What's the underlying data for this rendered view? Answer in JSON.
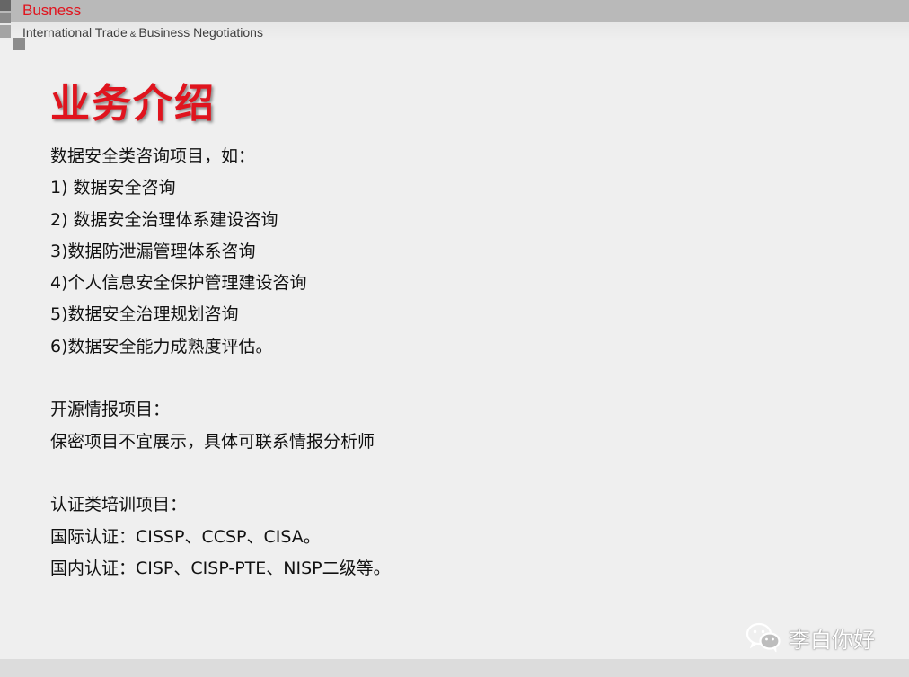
{
  "header": {
    "brand": "Busness",
    "subtitle_part1": "International Trade",
    "subtitle_amp": "&",
    "subtitle_part2": "Business Negotiations"
  },
  "title": "业务介绍",
  "content": {
    "lines": [
      "数据安全类咨询项目，如：",
      "1) 数据安全咨询",
      "2) 数据安全治理体系建设咨询",
      "3)数据防泄漏管理体系咨询",
      "4)个人信息安全保护管理建设咨询",
      "5)数据安全治理规划咨询",
      "6)数据安全能力成熟度评估。",
      "",
      "开源情报项目：",
      "保密项目不宜展示，具体可联系情报分析师",
      "",
      "认证类培训项目：",
      "国际认证：CISSP、CCSP、CISA。",
      "国内认证：CISP、CISP-PTE、NISP二级等。"
    ]
  },
  "watermark": {
    "icon": "wechat-icon",
    "text": "李白你好"
  },
  "colors": {
    "accent": "#e0141e",
    "background": "#efefef",
    "topbar": "#b9b9b9"
  }
}
